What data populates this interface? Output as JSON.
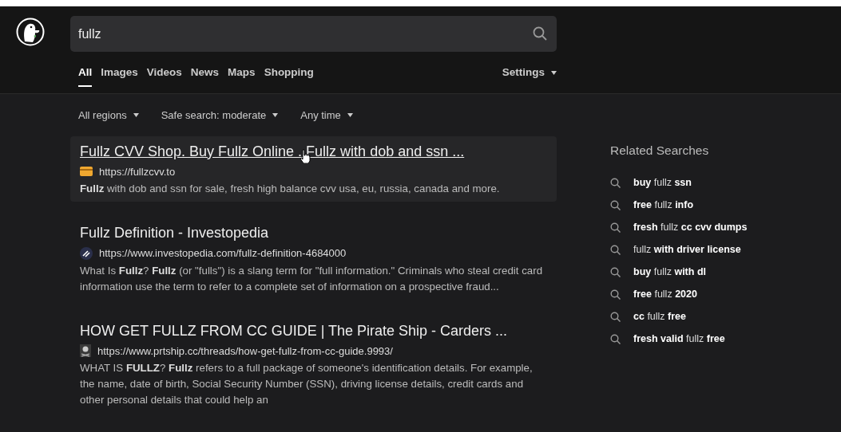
{
  "search": {
    "value": "fullz"
  },
  "tabs": [
    {
      "label": "All",
      "selected": true
    },
    {
      "label": "Images",
      "selected": false
    },
    {
      "label": "Videos",
      "selected": false
    },
    {
      "label": "News",
      "selected": false
    },
    {
      "label": "Maps",
      "selected": false
    },
    {
      "label": "Shopping",
      "selected": false
    }
  ],
  "settings": {
    "label": "Settings"
  },
  "filters": [
    {
      "label": "All regions"
    },
    {
      "label": "Safe search: moderate"
    },
    {
      "label": "Any time"
    }
  ],
  "results": [
    {
      "title": "Fullz CVV Shop. Buy Fullz Online . Fullz with dob and ssn ...",
      "url": "https://fullzcvv.to",
      "kind": "card",
      "highlighted": true,
      "snippet": "**Fullz** with dob and ssn for sale, fresh high balance cvv usa, eu, russia, canada and more."
    },
    {
      "title": "Fullz Definition - Investopedia",
      "url": "https://www.investopedia.com/fullz-definition-4684000",
      "kind": "letter",
      "highlighted": false,
      "snippet": "What Is **Fullz**? **Fullz** (or \"fulls\") is a slang term for \"full information.\" Criminals who steal credit card information use the term to refer to a complete set of information on a prospective fraud..."
    },
    {
      "title": "HOW GET FULLZ FROM CC GUIDE | The Pirate Ship - Carders ...",
      "url": "https://www.prtship.cc/threads/how-get-fullz-from-cc-guide.9993/",
      "kind": "skull",
      "highlighted": false,
      "snippet": "WHAT IS **FULLZ**? **Fullz** refers to a full package of someone's identification details. For example, the name, date of birth, Social Security Number (SSN), driving license details, credit cards and other personal details that could help an"
    }
  ],
  "related": {
    "title": "Related Searches",
    "items": [
      "**buy** fullz **ssn**",
      "**free** fullz **info**",
      "**fresh** fullz **cc cvv dumps**",
      "fullz **with driver license**",
      "**buy** fullz **with dl**",
      "**free** fullz **2020**",
      "**cc** fullz **free**",
      "**fresh valid** fullz **free**"
    ]
  }
}
